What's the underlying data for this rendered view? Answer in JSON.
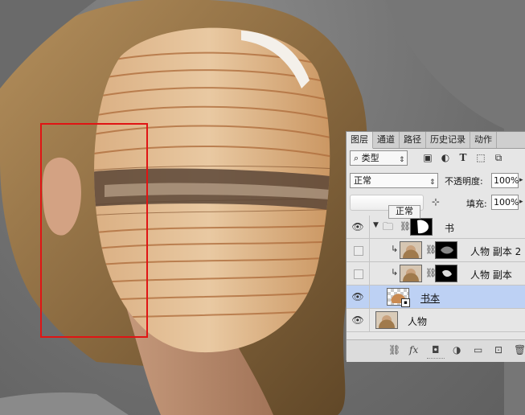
{
  "panel": {
    "tabs": [
      "图层",
      "通道",
      "路径",
      "历史记录",
      "动作"
    ],
    "active_tab": "图层",
    "kind_filter": {
      "icon": "search-icon",
      "label": "类型"
    },
    "filter_icons": [
      "image-filter-icon",
      "adjustment-filter-icon",
      "type-filter-icon",
      "shape-filter-icon",
      "smart-object-filter-icon"
    ],
    "blend_mode": "正常",
    "opacity_label": "不透明度:",
    "opacity_value": "100%",
    "fill_label": "填充:",
    "fill_value": "100%",
    "tooltip": "正常",
    "layers": [
      {
        "name": "书",
        "type": "group",
        "visible": true,
        "expanded": true,
        "has_mask": true
      },
      {
        "name": "人物 副本 2",
        "type": "clipped-layer",
        "visible": false,
        "has_mask": true
      },
      {
        "name": "人物 副本",
        "type": "clipped-layer",
        "visible": false,
        "has_mask": true
      },
      {
        "name": "书本",
        "type": "smart-object",
        "visible": true,
        "selected": true
      },
      {
        "name": "人物",
        "type": "layer",
        "visible": true
      }
    ],
    "bottom_icons": [
      "link-layers-icon",
      "fx-icon",
      "add-mask-icon",
      "adjustment-layer-icon",
      "new-group-icon",
      "new-layer-icon",
      "delete-icon"
    ],
    "fx_label": "fx"
  },
  "colors": {
    "selection": "#e01414",
    "selected_layer": "#bdd1f4",
    "panel_bg": "#e6e6e6"
  }
}
